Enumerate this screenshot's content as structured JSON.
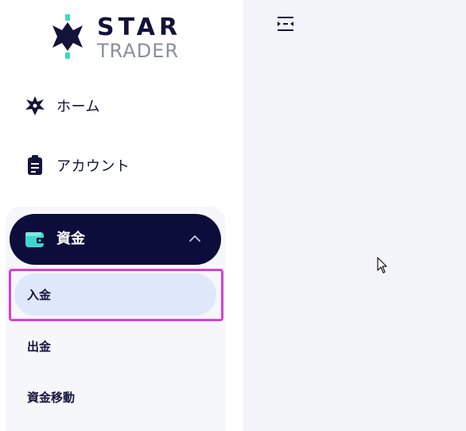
{
  "logo": {
    "brand_top": "STAR",
    "brand_bottom": "TRADER"
  },
  "nav": {
    "items": [
      {
        "label": "ホーム",
        "icon": "star-burst-icon"
      },
      {
        "label": "アカウント",
        "icon": "clipboard-icon"
      }
    ],
    "funds": {
      "label": "資金",
      "icon": "wallet-icon",
      "expanded": true,
      "subitems": [
        {
          "label": "入金",
          "active": true
        },
        {
          "label": "出金",
          "active": false
        },
        {
          "label": "資金移動",
          "active": false
        }
      ]
    }
  },
  "content": {
    "toggle_icon": "sidebar-collapse-icon"
  },
  "colors": {
    "brand_navy": "#0d0d3b",
    "brand_teal": "#3fd6cf",
    "active_bg": "#dfe7fb",
    "highlight_magenta": "#d63fd6",
    "content_bg": "#f3f4f9"
  }
}
